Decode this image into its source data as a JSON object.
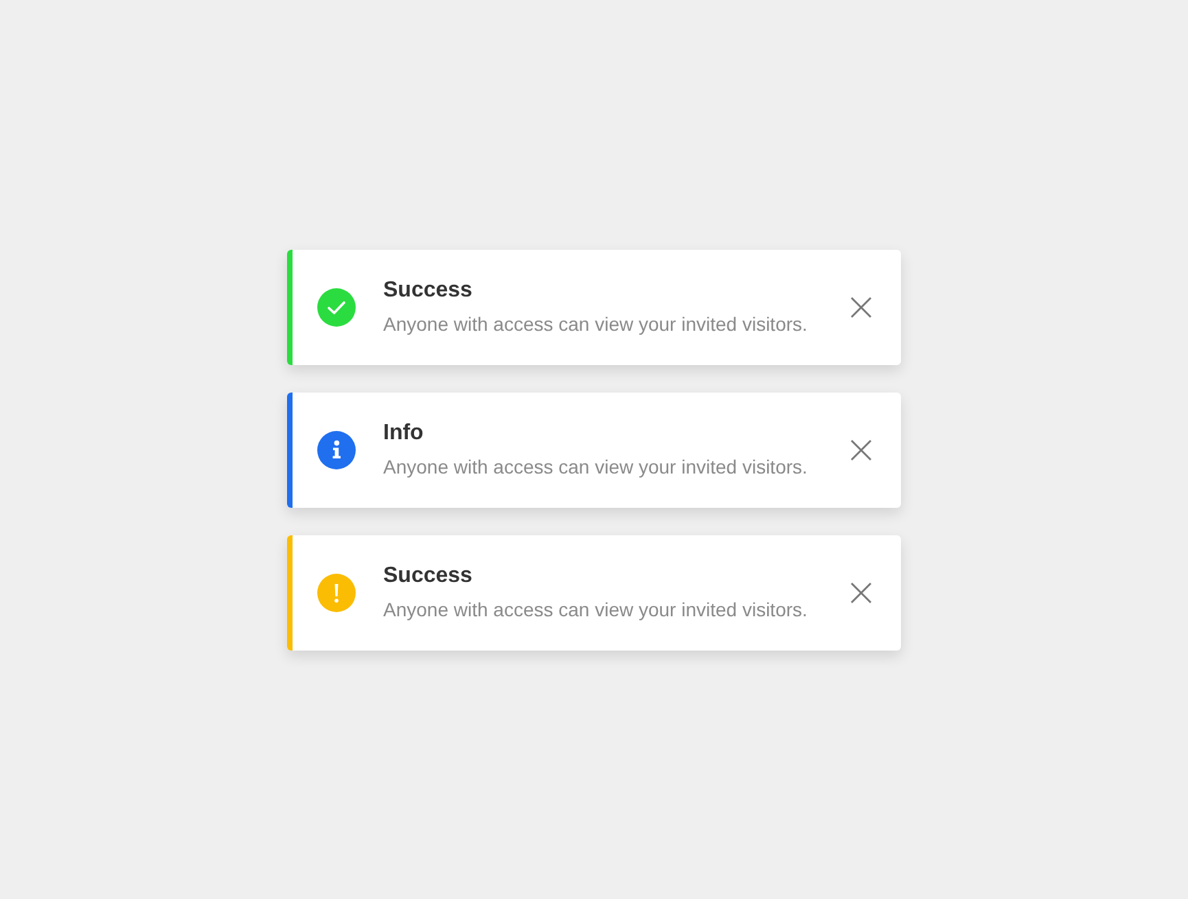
{
  "notifications": [
    {
      "kind": "success",
      "color": "#2bdc40",
      "title": "Success",
      "message": "Anyone with access can view your invited visitors."
    },
    {
      "kind": "info",
      "color": "#1f6fef",
      "title": "Info",
      "message": "Anyone with access can view your invited visitors."
    },
    {
      "kind": "warning",
      "color": "#fbbc04",
      "title": "Success",
      "message": "Anyone with access can view your invited visitors."
    }
  ]
}
